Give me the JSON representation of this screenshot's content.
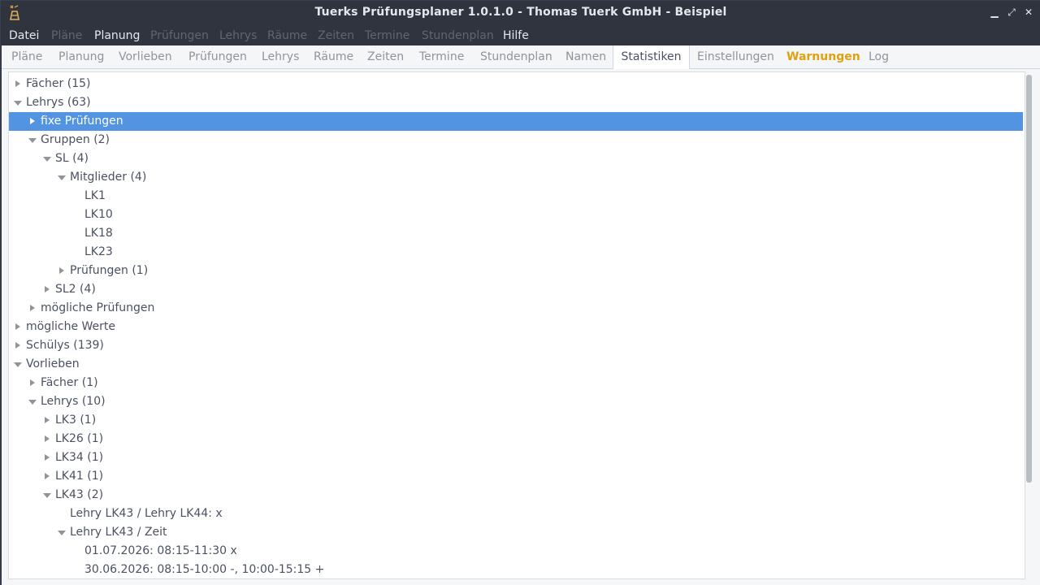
{
  "window": {
    "title": "Tuerks Prüfungsplaner 1.0.1.0 - Thomas Tuerk GmbH - Beispiel",
    "controls": {
      "minimize": "▁",
      "maximize": "⤢",
      "close": "✕"
    }
  },
  "menu": [
    {
      "label": "Datei",
      "enabled": true
    },
    {
      "label": "Pläne",
      "enabled": false
    },
    {
      "label": "Planung",
      "enabled": true
    },
    {
      "label": "Prüfungen",
      "enabled": false
    },
    {
      "label": "Lehrys",
      "enabled": false
    },
    {
      "label": "Räume",
      "enabled": false
    },
    {
      "label": "Zeiten",
      "enabled": false
    },
    {
      "label": "Termine",
      "enabled": false
    },
    {
      "label": "Stundenplan",
      "enabled": false
    },
    {
      "label": "Hilfe",
      "enabled": true
    }
  ],
  "tabs": [
    {
      "label": "Pläne"
    },
    {
      "label": "Planung"
    },
    {
      "label": "Vorlieben"
    },
    {
      "label": "Prüfungen"
    },
    {
      "label": "Lehrys"
    },
    {
      "label": "Räume"
    },
    {
      "label": "Zeiten"
    },
    {
      "label": "Termine"
    },
    {
      "label": "Stundenplan"
    },
    {
      "label": "Namen"
    },
    {
      "label": "Statistiken",
      "active": true
    },
    {
      "label": "Einstellungen"
    },
    {
      "label": "Warnungen",
      "warning": true
    },
    {
      "label": "Log"
    }
  ],
  "tree": [
    {
      "label": "Fächer (15)",
      "level": 0,
      "state": "collapsed"
    },
    {
      "label": "Lehrys (63)",
      "level": 0,
      "state": "expanded"
    },
    {
      "label": "fixe Prüfungen",
      "level": 1,
      "state": "collapsed",
      "selected": true
    },
    {
      "label": "Gruppen (2)",
      "level": 1,
      "state": "expanded"
    },
    {
      "label": "SL (4)",
      "level": 2,
      "state": "expanded"
    },
    {
      "label": "Mitglieder (4)",
      "level": 3,
      "state": "expanded"
    },
    {
      "label": "LK1",
      "level": 4,
      "state": "leaf"
    },
    {
      "label": "LK10",
      "level": 4,
      "state": "leaf"
    },
    {
      "label": "LK18",
      "level": 4,
      "state": "leaf"
    },
    {
      "label": "LK23",
      "level": 4,
      "state": "leaf"
    },
    {
      "label": "Prüfungen (1)",
      "level": 3,
      "state": "collapsed"
    },
    {
      "label": "SL2 (4)",
      "level": 2,
      "state": "collapsed"
    },
    {
      "label": "mögliche Prüfungen",
      "level": 1,
      "state": "collapsed"
    },
    {
      "label": "mögliche Werte",
      "level": 0,
      "state": "collapsed"
    },
    {
      "label": "Schülys (139)",
      "level": 0,
      "state": "collapsed"
    },
    {
      "label": "Vorlieben",
      "level": 0,
      "state": "expanded"
    },
    {
      "label": "Fächer (1)",
      "level": 1,
      "state": "collapsed"
    },
    {
      "label": "Lehrys (10)",
      "level": 1,
      "state": "expanded"
    },
    {
      "label": "LK3 (1)",
      "level": 2,
      "state": "collapsed"
    },
    {
      "label": "LK26 (1)",
      "level": 2,
      "state": "collapsed"
    },
    {
      "label": "LK34 (1)",
      "level": 2,
      "state": "collapsed"
    },
    {
      "label": "LK41 (1)",
      "level": 2,
      "state": "collapsed"
    },
    {
      "label": "LK43 (2)",
      "level": 2,
      "state": "expanded"
    },
    {
      "label": "Lehry LK43 / Lehry LK44: x",
      "level": 3,
      "state": "leaf"
    },
    {
      "label": "Lehry LK43 / Zeit",
      "level": 3,
      "state": "expanded"
    },
    {
      "label": "01.07.2026: 08:15-11:30 x",
      "level": 4,
      "state": "leaf"
    },
    {
      "label": "30.06.2026: 08:15-10:00 -, 10:00-15:15 +",
      "level": 4,
      "state": "leaf"
    }
  ]
}
